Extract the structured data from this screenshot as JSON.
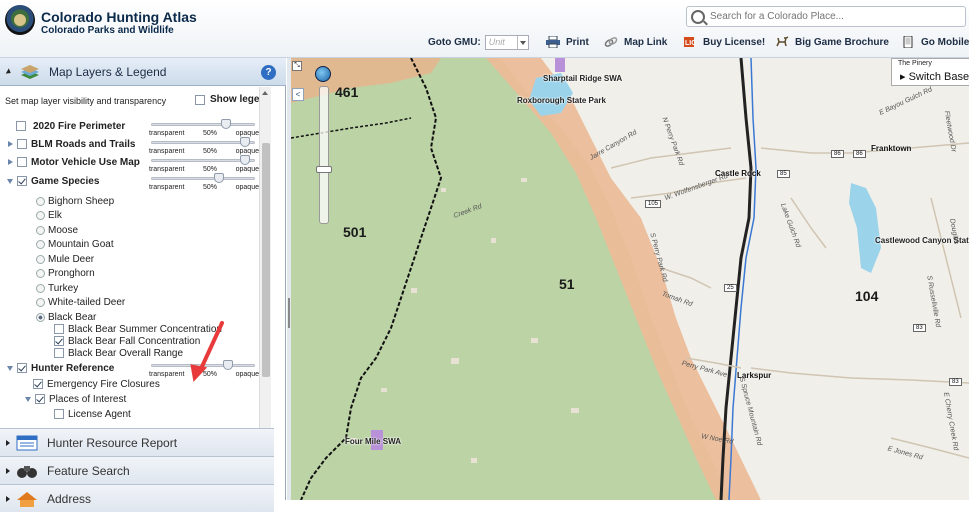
{
  "header": {
    "title": "Colorado Hunting Atlas",
    "subtitle": "Colorado Parks and Wildlife",
    "search_placeholder": "Search for a Colorado Place..."
  },
  "toolbar": {
    "goto_label": "Goto GMU:",
    "gmu_value": "Unit",
    "print": "Print",
    "map_link": "Map Link",
    "buy_license": "Buy License!",
    "big_game": "Big Game Brochure",
    "go_mobile": "Go Mobile"
  },
  "panel": {
    "title": "Map Layers & Legend",
    "help": "?",
    "visibility_note": "Set map layer visibility and transparency",
    "show_legend": "Show legend",
    "slider_labels": {
      "left": "transparent",
      "mid": "50%",
      "right": "opaque"
    },
    "layers": [
      {
        "label": "2020 Fire Perimeter",
        "checked": false,
        "expander": "none",
        "opacity": 0.75
      },
      {
        "label": "BLM Roads and Trails",
        "checked": false,
        "expander": "closed",
        "opacity": 0.95
      },
      {
        "label": "Motor Vehicle Use Map",
        "checked": false,
        "expander": "closed",
        "opacity": 0.95
      },
      {
        "label": "Game Species",
        "checked": true,
        "expander": "open",
        "opacity": 0.68
      }
    ],
    "species": [
      "Bighorn Sheep",
      "Elk",
      "Moose",
      "Mountain Goat",
      "Mule Deer",
      "Pronghorn",
      "Turkey",
      "White-tailed Deer",
      "Black Bear"
    ],
    "selected_species": "Black Bear",
    "bear_layers": [
      {
        "label": "Black Bear Summer Concentration",
        "checked": false
      },
      {
        "label": "Black Bear Fall Concentration",
        "checked": true
      },
      {
        "label": "Black Bear Overall Range",
        "checked": false
      }
    ],
    "hunter_reference": {
      "label": "Hunter Reference",
      "checked": true,
      "opacity": 0.77
    },
    "emergency": "Emergency Fire Closures",
    "places": "Places of Interest",
    "license_agent": "License Agent"
  },
  "accordion": {
    "hunter_report": "Hunter Resource Report",
    "feature_search": "Feature Search",
    "address": "Address"
  },
  "map": {
    "switch_hint": "The Pinery",
    "switch_label": "Switch Basemap",
    "gmus": [
      "461",
      "501",
      "51",
      "104"
    ],
    "places": {
      "sharptail": "Sharptail Ridge SWA",
      "roxborough": "Roxborough State Park",
      "castlewood": "Castlewood Canyon State Park",
      "fourmile": "Four Mile SWA"
    },
    "towns": {
      "castle_rock": "Castle Rock",
      "franktown": "Franktown",
      "larkspur": "Larkspur"
    },
    "roads": {
      "jarre": "Jarre Canyon Rd",
      "perry_park": "N Perry Park Rd",
      "wolfensberger": "W. Wolfensberger Rd",
      "creek": "Creek Rd",
      "s_perry": "S Perry Park Rd",
      "tomah": "Tomah Rd",
      "spruce": "S Spruce Mountain Rd",
      "perry_ave": "Perry Park Ave",
      "noe": "W Noe Rd",
      "bayou": "E Bayou Gulch Rd",
      "fleet": "Fleetwood Dr",
      "lake_gulch": "Lake Gulch Rd",
      "cherry": "E Cherry Creek Rd",
      "russellville": "S Russellville Rd",
      "jones": "E Jones Rd",
      "douglas": "Douglas"
    },
    "shields": [
      "86",
      "85",
      "105",
      "25",
      "83",
      "83",
      "86"
    ],
    "colors": {
      "forest": "#bcd3a6",
      "gmu_orange": "#ecba96",
      "swa": "#b891d8",
      "water": "#9ad3ea",
      "rail": "#222222"
    }
  }
}
